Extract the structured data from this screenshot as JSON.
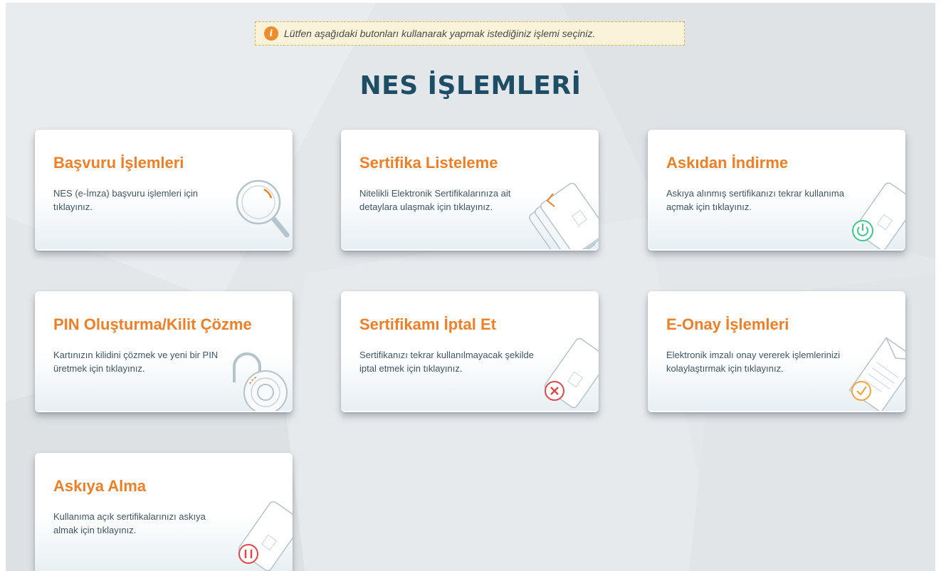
{
  "notice": {
    "icon": "info-icon",
    "text": "Lütfen aşağıdaki butonları kullanarak yapmak istediğiniz işlemi seçiniz."
  },
  "page_title": "NES İŞLEMLERİ",
  "colors": {
    "accent": "#ee7f27",
    "title": "#1e4d66",
    "desc": "#3e5566",
    "success": "#3ec98b",
    "danger": "#e04848"
  },
  "cards": [
    {
      "title": "Başvuru İşlemleri",
      "desc": "NES (e-İmza) başvuru işlemleri için tıklayınız.",
      "icon": "magnifier-icon"
    },
    {
      "title": "Sertifika Listeleme",
      "desc": "Nitelikli Elektronik Sertifikalarınıza ait detaylara ulaşmak için tıklayınız.",
      "icon": "card-list-icon"
    },
    {
      "title": "Askıdan İndirme",
      "desc": "Askıya alınmış sertifikanızı tekrar kullanıma açmak için tıklayınız.",
      "icon": "card-power-icon"
    },
    {
      "title": "PIN Oluşturma/Kilit Çözme",
      "desc": "Kartınızın kilidini çözmek ve yeni bir PIN üretmek için tıklayınız.",
      "icon": "padlock-icon"
    },
    {
      "title": "Sertifikamı İptal Et",
      "desc": "Sertifikanızı tekrar kullanılmayacak şekilde iptal etmek için tıklayınız.",
      "icon": "card-cancel-icon"
    },
    {
      "title": "E-Onay İşlemleri",
      "desc": "Elektronik imzalı onay vererek işlemlerinizi kolaylaştırmak için tıklayınız.",
      "icon": "document-check-icon"
    },
    {
      "title": "Askıya Alma",
      "desc": "Kullanıma açık sertifikalarınızı askıya almak için tıklayınız.",
      "icon": "card-pause-icon"
    }
  ]
}
